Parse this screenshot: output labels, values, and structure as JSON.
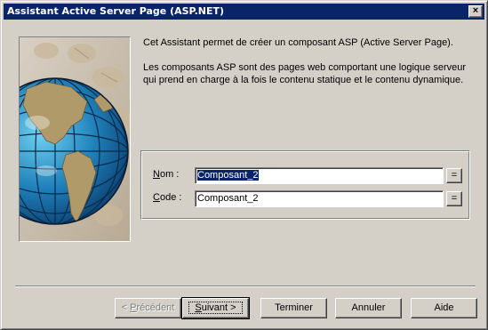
{
  "window": {
    "title": "Assistant Active Server Page (ASP.NET)",
    "close_label": "×"
  },
  "intro": {
    "line1": "Cet Assistant permet de créer un composant ASP (Active Server Page).",
    "line2": "Les composants ASP sont des pages web comportant une logique serveur qui prend en charge à la fois le contenu statique et le contenu dynamique."
  },
  "form": {
    "nom": {
      "label_underlined": "N",
      "label_rest": "om :",
      "value": "Composant_2",
      "eq_label": "="
    },
    "code": {
      "label_underlined": "C",
      "label_rest": "ode :",
      "value": "Composant_2",
      "eq_label": "="
    }
  },
  "buttons": {
    "previous": {
      "prefix": "< ",
      "underlined": "P",
      "rest": "récédent",
      "enabled": false
    },
    "next": {
      "underlined": "S",
      "rest": "uivant >",
      "enabled": true
    },
    "finish": "Terminer",
    "cancel": "Annuler",
    "help": "Aide"
  },
  "colors": {
    "titlebar": "#0a246a",
    "dialog_bg": "#d4d0c8",
    "globe_ocean": "#1e7fb8",
    "globe_land": "#b09a6a"
  }
}
